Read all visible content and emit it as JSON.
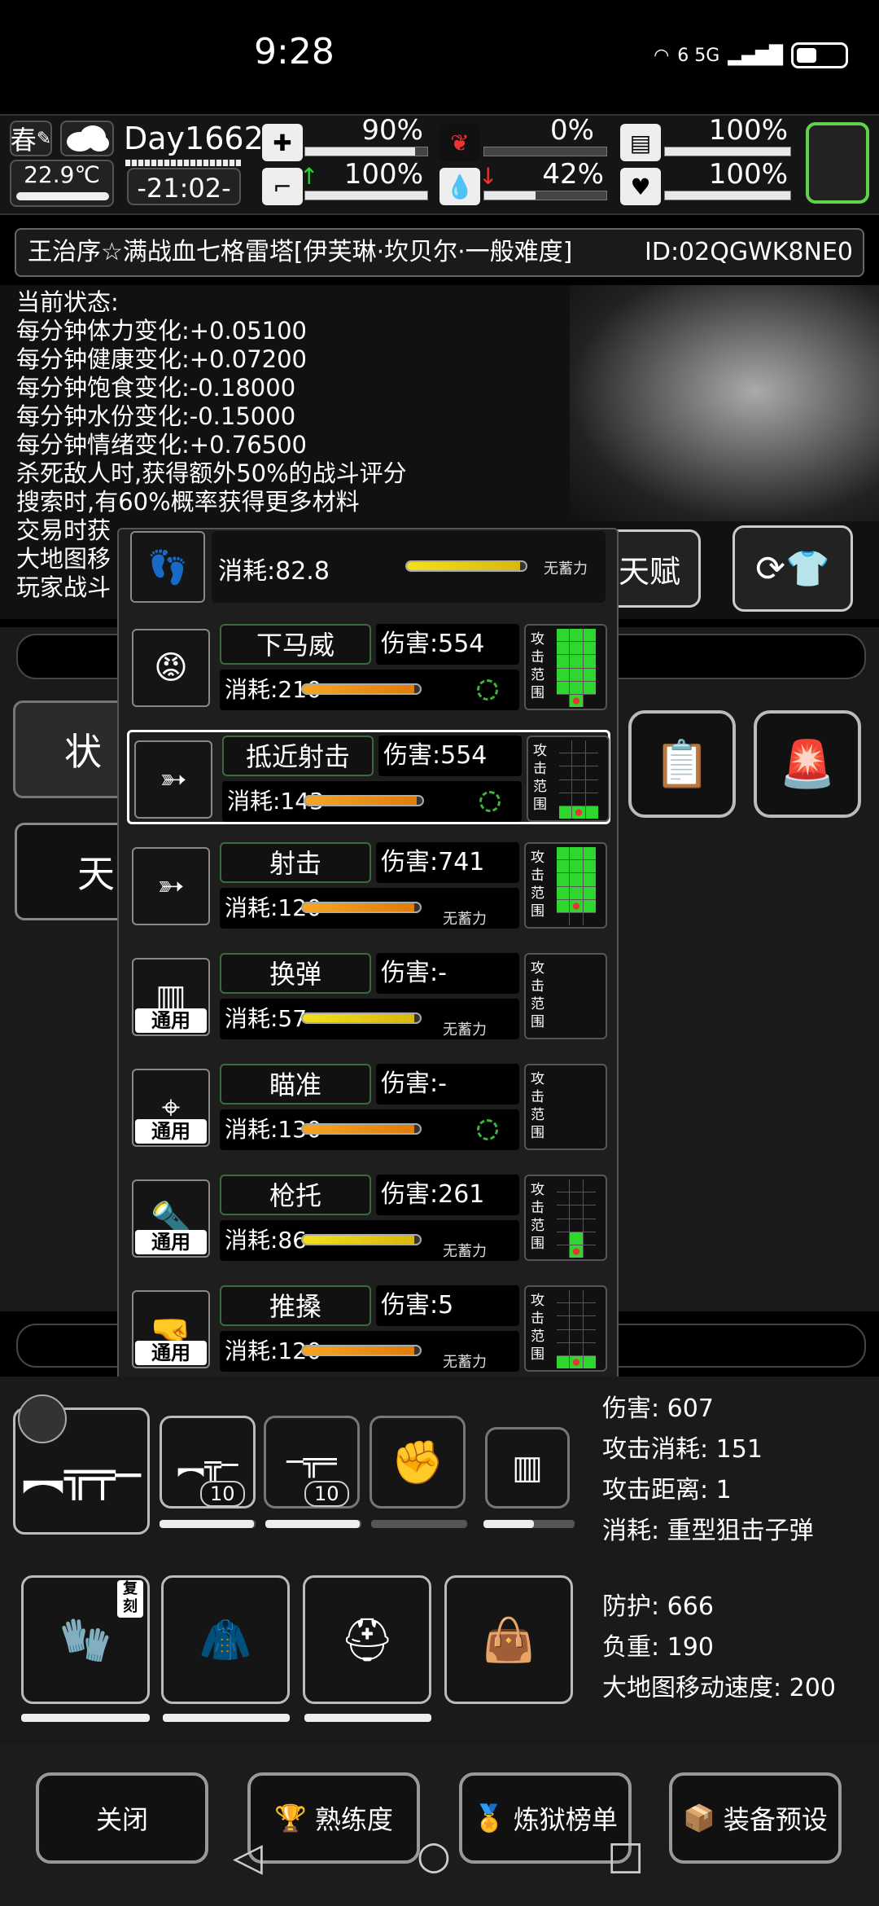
{
  "status_bar": {
    "time": "9:28",
    "network": "6 5G"
  },
  "hud": {
    "season": "春",
    "temperature": "22.9℃",
    "day": "Day1662",
    "clock": "-21:02-",
    "stats": [
      {
        "label": "health",
        "value": "90%",
        "level": 0.9
      },
      {
        "label": "stomach",
        "value": "0%",
        "level": 0.0
      },
      {
        "label": "water-tank",
        "value": "100%",
        "level": 1.0
      },
      {
        "label": "stamina",
        "value": "100%",
        "level": 1.0
      },
      {
        "label": "water",
        "value": "42%",
        "level": 0.42
      },
      {
        "label": "mood",
        "value": "100%",
        "level": 1.0
      }
    ]
  },
  "player": {
    "name": "王治序☆满战血七格雷塔[伊芙琳·坎贝尔·一般难度]",
    "id": "ID:02QGWK8NE0"
  },
  "status": {
    "title": "当前状态:",
    "lines": [
      "每分钟体力变化:+0.05100",
      "每分钟健康变化:+0.07200",
      "每分钟饱食变化:-0.18000",
      "每分钟水份变化:-0.15000",
      "每分钟情绪变化:+0.76500",
      "杀死敌人时,获得额外50%的战斗评分",
      "搜索时,有60%概率获得更多材料",
      "交易时获",
      "大地图移",
      "玩家战斗"
    ],
    "talent_btn": "天赋"
  },
  "tabs": {
    "tab1": "状",
    "tab2": "天"
  },
  "popup": {
    "top": {
      "cost": "消耗:82.8",
      "tag": "无蓄力",
      "level": 0.95
    },
    "skills": [
      {
        "name": "下马威",
        "damage": "伤害:554",
        "cost": "消耗:210",
        "level": 0.95,
        "tag": "",
        "ring": true,
        "general": false,
        "range": [
          1,
          1,
          1,
          1,
          1,
          1,
          1,
          1,
          1,
          1,
          1,
          1,
          1,
          1,
          1,
          0,
          2,
          0
        ]
      },
      {
        "name": "抵近射击",
        "damage": "伤害:554",
        "cost": "消耗:143",
        "level": 0.95,
        "tag": "",
        "ring": true,
        "general": false,
        "selected": true,
        "range": [
          0,
          0,
          0,
          0,
          0,
          0,
          0,
          0,
          0,
          0,
          0,
          0,
          0,
          0,
          0,
          1,
          2,
          1
        ]
      },
      {
        "name": "射击",
        "damage": "伤害:741",
        "cost": "消耗:120",
        "level": 0.95,
        "tag": "无蓄力",
        "ring": false,
        "general": false,
        "range": [
          1,
          1,
          1,
          1,
          1,
          1,
          1,
          1,
          1,
          1,
          1,
          1,
          1,
          2,
          1,
          0,
          0,
          0
        ]
      },
      {
        "name": "换弹",
        "damage": "伤害:-",
        "cost": "消耗:57",
        "level": 0.95,
        "tag": "无蓄力",
        "ring": false,
        "general": true,
        "yellow": true,
        "range": null
      },
      {
        "name": "瞄准",
        "damage": "伤害:-",
        "cost": "消耗:130",
        "level": 0.95,
        "tag": "",
        "ring": true,
        "general": true,
        "range": null
      },
      {
        "name": "枪托",
        "damage": "伤害:261",
        "cost": "消耗:86",
        "level": 0.95,
        "tag": "无蓄力",
        "ring": false,
        "general": true,
        "yellow": true,
        "range": [
          0,
          0,
          0,
          0,
          0,
          0,
          0,
          0,
          0,
          0,
          0,
          0,
          0,
          1,
          0,
          0,
          2,
          0
        ]
      },
      {
        "name": "推搡",
        "damage": "伤害:5",
        "cost": "消耗:120",
        "level": 0.95,
        "tag": "无蓄力",
        "ring": false,
        "general": true,
        "range": [
          0,
          0,
          0,
          0,
          0,
          0,
          0,
          0,
          0,
          0,
          0,
          0,
          0,
          0,
          0,
          1,
          2,
          1
        ]
      }
    ],
    "general_label": "通用",
    "range_label": "攻击范围"
  },
  "weapon": {
    "stats": [
      "伤害: 607",
      "攻击消耗: 151",
      "攻击距离: 1",
      "消耗: 重型狙击子弹"
    ],
    "slot2_count": "10",
    "slot3_count": "10",
    "slot1_level": 0.0,
    "slot2_level": 0.98,
    "slot3_level": 0.98,
    "slot4_level": 0.0,
    "slot5_level": 0.55
  },
  "armor": {
    "stats": [
      "防护: 666",
      "负重: 190",
      "大地图移动速度: 200"
    ],
    "slot1_badge": "复刻"
  },
  "footer": {
    "close": "关闭",
    "proficiency": "熟练度",
    "ranking": "炼狱榜单",
    "preset": "装备预设"
  }
}
